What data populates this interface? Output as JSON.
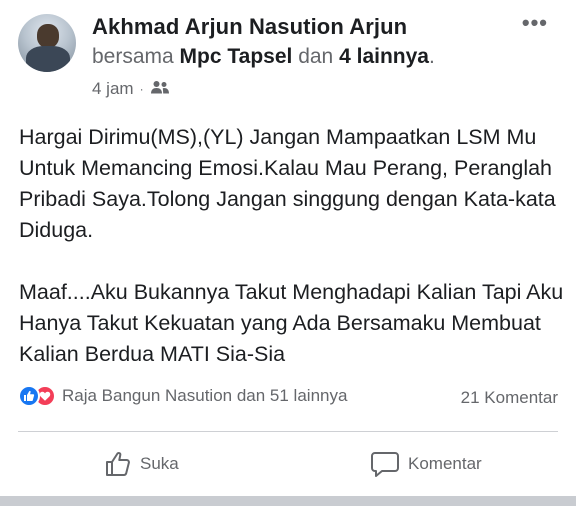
{
  "post": {
    "author": "Akhmad Arjun Nasution Arjun",
    "with_prefix": "bersama",
    "with_person": "Mpc Tapsel",
    "with_and": "dan",
    "with_others": "4 lainnya",
    "with_suffix": ".",
    "time": "4 jam",
    "audience_icon": "friends-icon",
    "more_label": "•••",
    "paragraphs": [
      "Hargai Dirimu(MS),(YL) Jangan Mampaatkan LSM Mu Untuk Memancing Emosi.Kalau Mau Perang, Peranglah Pribadi Saya.Tolong Jangan singgung dengan Kata-kata Diduga.",
      "Maaf....Aku Bukannya Takut Menghadapi Kalian Tapi  Aku Hanya Takut Kekuatan yang Ada Bersamaku Membuat Kalian Berdua MATI Sia-Sia"
    ]
  },
  "engagement": {
    "reactions_text": "Raja Bangun Nasution dan 51 lainnya",
    "comments_text": "21 Komentar",
    "reaction_icons": [
      "like-icon",
      "love-icon"
    ]
  },
  "actions": {
    "like_label": "Suka",
    "comment_label": "Komentar"
  },
  "colors": {
    "like_blue": "#1877f2",
    "love_red": "#f33e58",
    "secondary_text": "#65676b",
    "primary_text": "#1c1e21"
  }
}
